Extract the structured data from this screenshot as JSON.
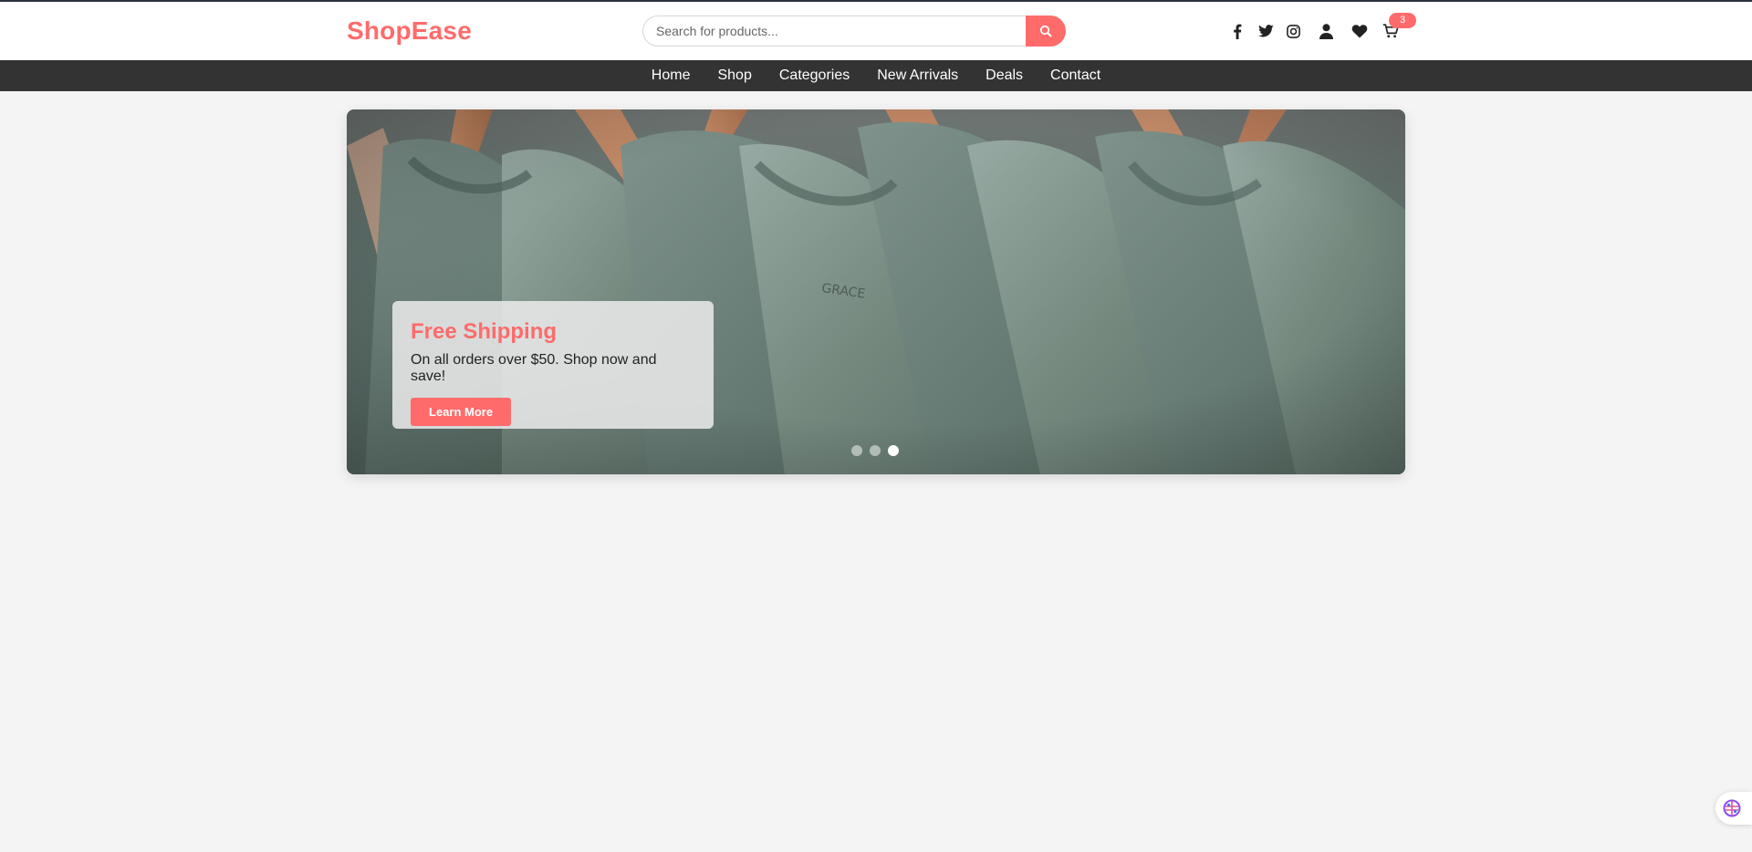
{
  "header": {
    "logo": "ShopEase",
    "search": {
      "placeholder": "Search for products...",
      "value": ""
    },
    "icons": [
      "facebook-icon",
      "twitter-icon",
      "instagram-icon",
      "user-icon",
      "heart-icon",
      "cart-icon"
    ],
    "cart_count": "3"
  },
  "nav": {
    "items": [
      {
        "label": "Home"
      },
      {
        "label": "Shop"
      },
      {
        "label": "Categories"
      },
      {
        "label": "New Arrivals"
      },
      {
        "label": "Deals"
      },
      {
        "label": "Contact"
      }
    ]
  },
  "hero": {
    "title": "Free Shipping",
    "text": "On all orders over $50. Shop now and save!",
    "button": "Learn More",
    "slides_count": 3,
    "active_slide": 3
  },
  "colors": {
    "accent": "#ff6b6b",
    "nav_bg": "#333333",
    "page_bg": "#f4f4f4"
  }
}
